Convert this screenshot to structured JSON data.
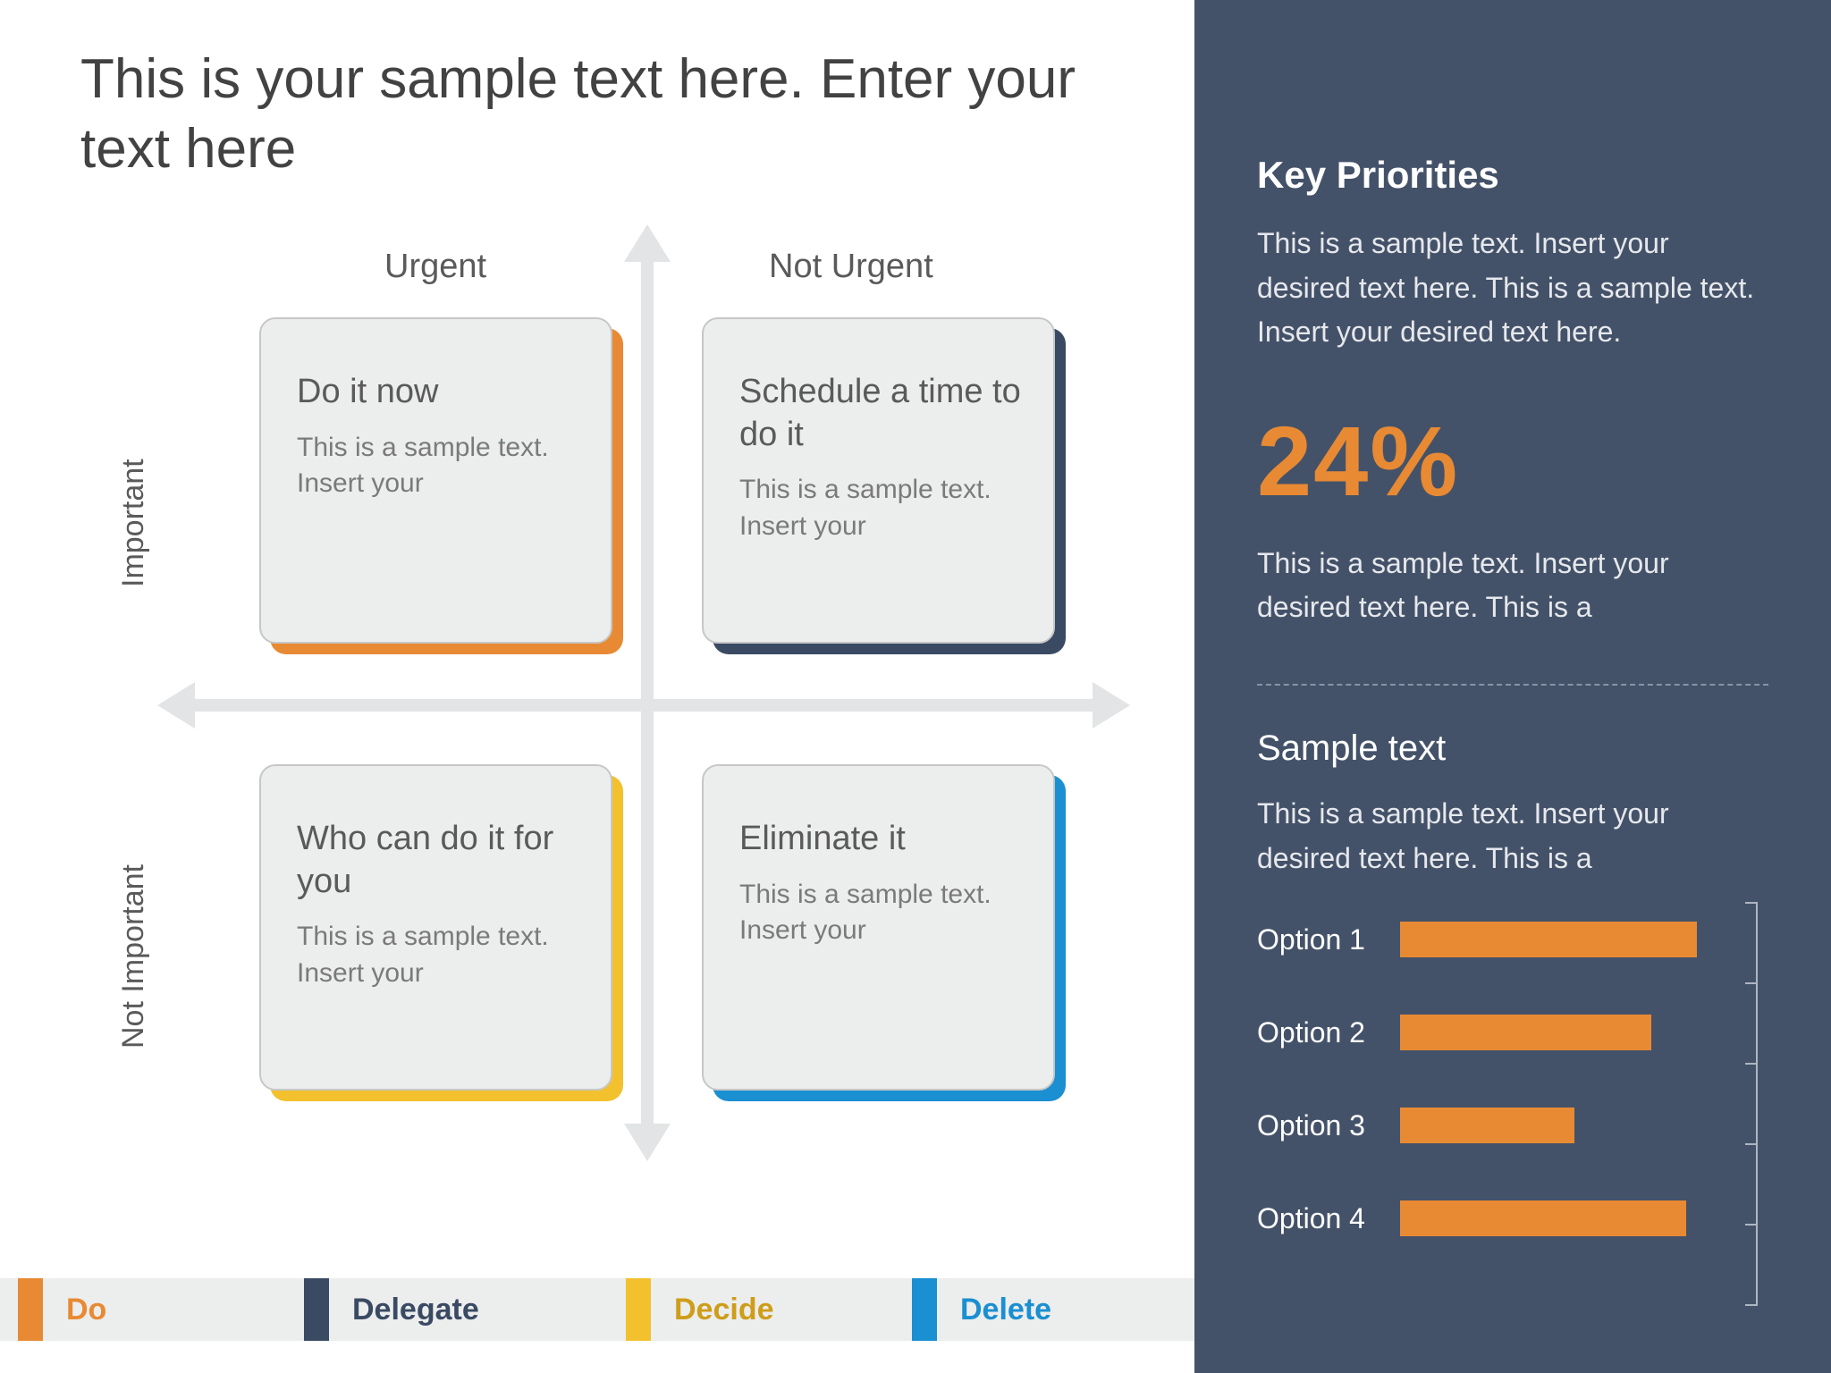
{
  "title": "This is your sample text here. Enter your text here",
  "matrix": {
    "columns": {
      "urgent": "Urgent",
      "not_urgent": "Not Urgent"
    },
    "rows": {
      "important": "Important",
      "not_important": "Not Important"
    },
    "quadrants": [
      {
        "id": "do",
        "title": "Do it now",
        "body": "This is a sample text. Insert your",
        "accent": "#e88a33"
      },
      {
        "id": "decide",
        "title": "Schedule a time to do it",
        "body": "This is a sample text. Insert your",
        "accent": "#3a4a63"
      },
      {
        "id": "delegate",
        "title": "Who can do it for you",
        "body": "This is a sample text. Insert your",
        "accent": "#f3c02e"
      },
      {
        "id": "delete",
        "title": "Eliminate it",
        "body": "This is a sample text. Insert your",
        "accent": "#1a8fd1"
      }
    ]
  },
  "legend": [
    {
      "label": "Do",
      "color": "#e88a33"
    },
    {
      "label": "Delegate",
      "color": "#3a4a63"
    },
    {
      "label": "Decide",
      "color": "#f3c02e"
    },
    {
      "label": "Delete",
      "color": "#1a8fd1"
    }
  ],
  "sidebar": {
    "kp_title": "Key Priorities",
    "kp_body": "This is a sample text.  Insert your desired text here. This is a sample text.  Insert your desired text here.",
    "stat": "24%",
    "stat_body": "This is a sample text.  Insert your desired text here. This is a",
    "st_title": "Sample text",
    "st_body": "This is a sample text.  Insert your desired text here. This is a"
  },
  "chart_data": {
    "type": "bar",
    "orientation": "horizontal",
    "categories": [
      "Option 1",
      "Option 2",
      "Option 3",
      "Option 4"
    ],
    "values": [
      85,
      72,
      50,
      82
    ],
    "xlim": [
      0,
      100
    ],
    "bar_color": "#e88a33"
  }
}
